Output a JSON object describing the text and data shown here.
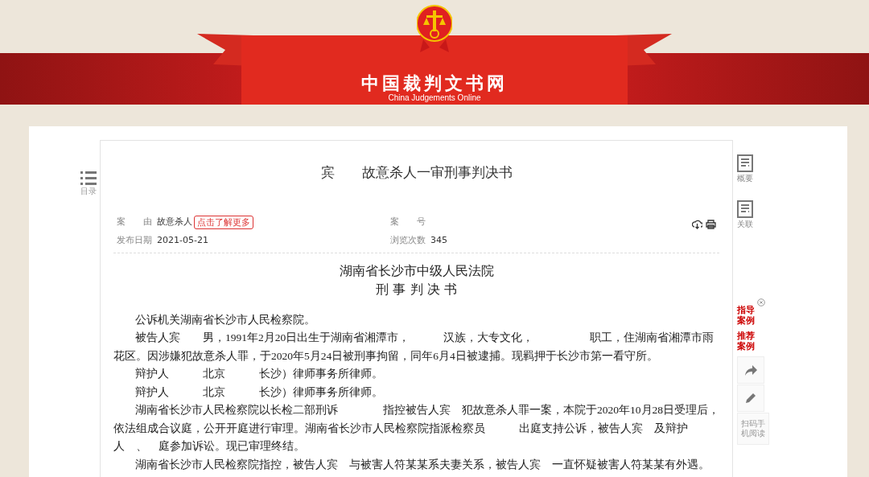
{
  "header": {
    "site_title": "中国裁判文书网",
    "site_subtitle": "China Judgements Online"
  },
  "toc": {
    "label": "目录"
  },
  "document": {
    "title": "宾　　故意杀人一审刑事判决书",
    "meta": [
      {
        "label": "案　　由",
        "value": "故意杀人",
        "tag": "点击了解更多"
      },
      {
        "label": "案　　号"
      },
      {
        "label": "发布日期",
        "value": "2021-05-21"
      },
      {
        "label": "浏览次数",
        "value": "345"
      }
    ],
    "court": "湖南省长沙市中级人民法院",
    "doc_type": "刑 事 判 决 书",
    "paragraphs": [
      "公诉机关湖南省长沙市人民检察院。",
      "被告人宾　　男，1991年2月20日出生于湖南省湘潭市，　　　汉族，大专文化，　　　　　职工，住湖南省湘潭市雨花区。因涉嫌犯故意杀人罪，于2020年5月24日被刑事拘留，同年6月4日被逮捕。现羁押于长沙市第一看守所。",
      "辩护人　　　北京　　　长沙）律师事务所律师。",
      "辩护人　　　北京　　　长沙）律师事务所律师。",
      "湖南省长沙市人民检察院以长检二部刑诉　　　　指控被告人宾　犯故意杀人罪一案，本院于2020年10月28日受理后，依法组成合议庭，公开开庭进行审理。湖南省长沙市人民检察院指派检察员　　　出庭支持公诉，被告人宾　及辩护人　、　庭参加诉讼。现已审理终结。",
      "湖南省长沙市人民检察院指控，被告人宾　与被害人符某某系夫妻关系，被告人宾　一直怀疑被害人符某某有外遇。"
    ]
  },
  "side_tools": [
    {
      "label": "概要"
    },
    {
      "label": "关联"
    }
  ],
  "promo": [
    "指导案例",
    "推荐案例"
  ],
  "actions": [
    {
      "kind": "share"
    },
    {
      "kind": "edit"
    },
    {
      "kind": "text",
      "label": "扫码手机阅读"
    }
  ]
}
